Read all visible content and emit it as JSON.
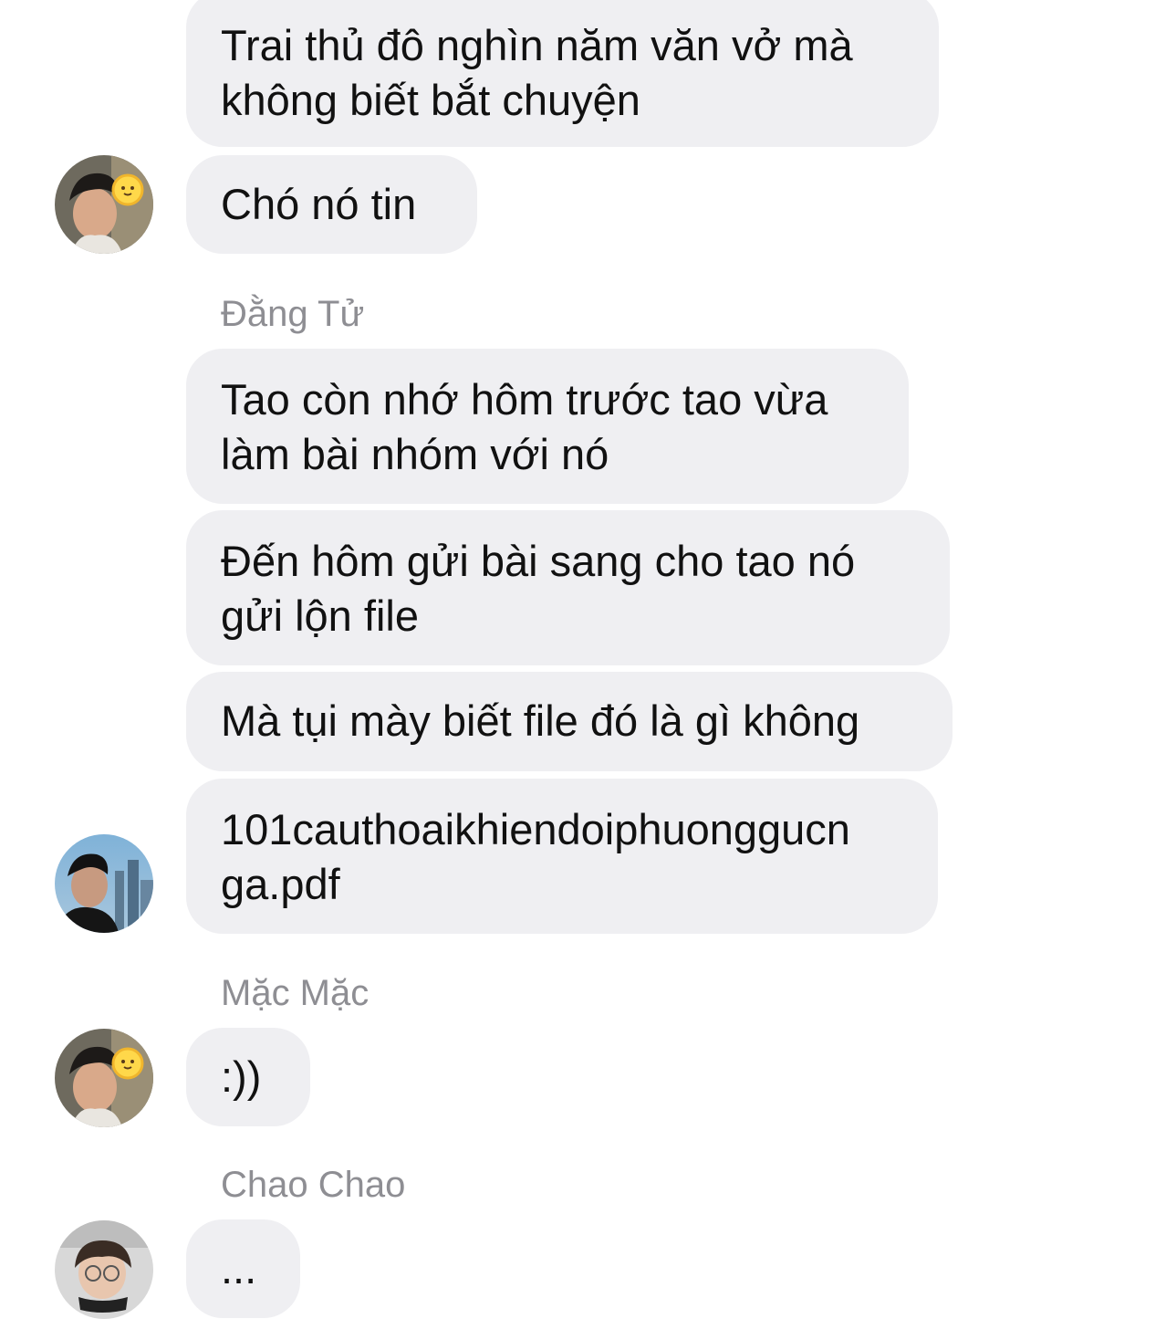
{
  "messages": [
    {
      "lines": [
        "Trai thủ đô nghìn năm văn vở mà",
        "không biết bắt chuyện"
      ]
    },
    {
      "lines": [
        "Chó nó tin"
      ]
    },
    {
      "sender": "Đằng Tử"
    },
    {
      "lines": [
        "Tao còn nhớ hôm trước tao vừa",
        "làm bài nhóm với nó"
      ]
    },
    {
      "lines": [
        "Đến hôm gửi bài sang cho tao nó",
        "gửi lộn file"
      ]
    },
    {
      "lines": [
        "Mà tụi mày biết file đó là gì không"
      ]
    },
    {
      "lines": [
        "101cauthoaikhiendoiphuonggucn",
        "ga.pdf"
      ]
    },
    {
      "sender": "Mặc Mặc"
    },
    {
      "lines": [
        ":))"
      ]
    },
    {
      "sender": "Chao Chao"
    },
    {
      "lines": [
        "..."
      ]
    }
  ]
}
